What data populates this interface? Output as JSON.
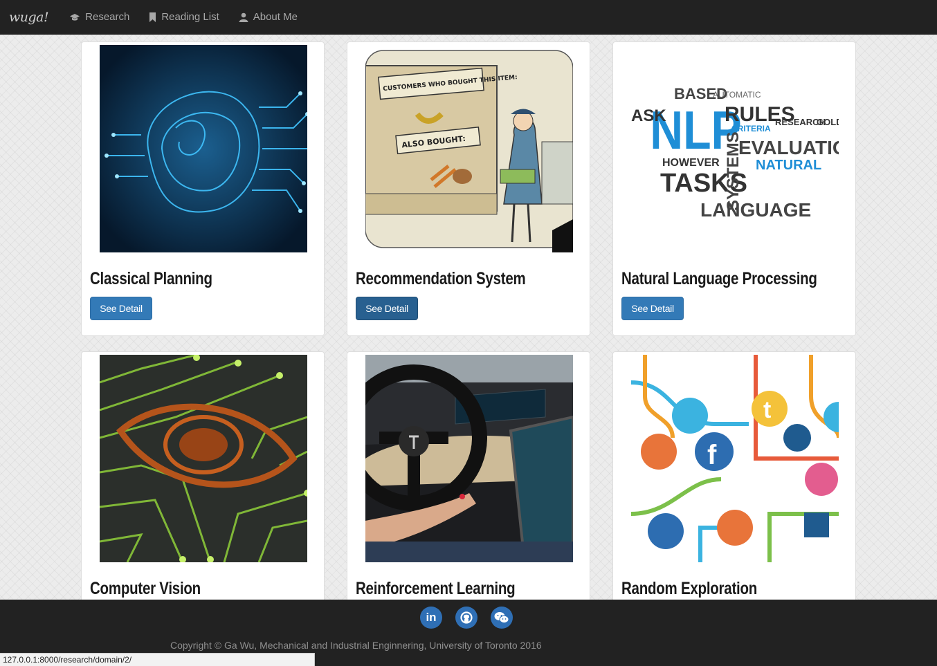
{
  "navbar": {
    "brand": "wuga!",
    "items": [
      {
        "label": "Research",
        "icon": "graduation-cap-icon"
      },
      {
        "label": "Reading List",
        "icon": "bookmark-icon"
      },
      {
        "label": "About Me",
        "icon": "user-icon"
      }
    ]
  },
  "cards": [
    {
      "title": "Classical Planning",
      "button": "See Detail",
      "image": "brain-circuit-image"
    },
    {
      "title": "Recommendation System",
      "button": "See Detail",
      "image": "cartoon-image"
    },
    {
      "title": "Natural Language Processing",
      "button": "See Detail",
      "image": "word-cloud-image"
    },
    {
      "title": "Computer Vision",
      "button": "See Detail",
      "image": "eye-circuit-image"
    },
    {
      "title": "Reinforcement Learning",
      "button": "See Detail",
      "image": "self-driving-car-image"
    },
    {
      "title": "Random Exploration",
      "button": "See Detail",
      "image": "social-icons-image"
    }
  ],
  "cartoon": {
    "sign1": "CUSTOMERS WHO BOUGHT THIS ITEM:",
    "sign2": "ALSO BOUGHT:"
  },
  "wordcloud": {
    "big": "NLP",
    "words": [
      "BASED",
      "AUTOMATIC",
      "RULES",
      "ASK",
      "CRITERIA",
      "EVALUATION",
      "HOWEVER",
      "TASKS",
      "SYSTEMS",
      "NATURAL",
      "LANGUAGE",
      "RESEARCH",
      "GOLD"
    ]
  },
  "footer": {
    "social": [
      "linkedin-icon",
      "github-icon",
      "wechat-icon"
    ],
    "social_labels": [
      "in"
    ],
    "copyright": "Copyright © Ga Wu, Mechanical and Industrial Enginnering, University of Toronto 2016"
  },
  "statusbar": {
    "url": "127.0.0.1:8000/research/domain/2/"
  },
  "colors": {
    "navbar": "#222222",
    "button": "#337ab7",
    "button_active": "#286090",
    "social": "#2f6fb5"
  }
}
